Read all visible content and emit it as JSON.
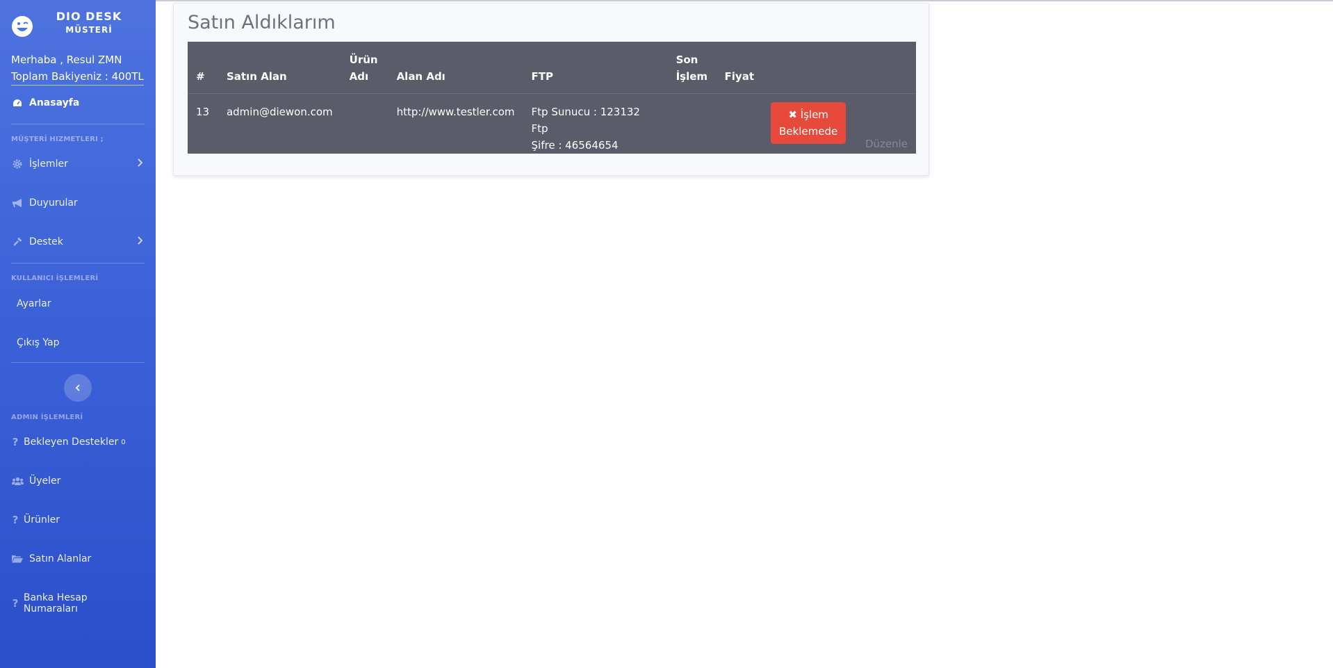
{
  "brand": {
    "title": "DIO DESK",
    "subtitle": "MÜSTERİ"
  },
  "user": {
    "greeting": "Merhaba , Resul ZMN",
    "balance": "Toplam Bakiyeniz : 400TL"
  },
  "nav": {
    "home": "Anasayfa",
    "heading_customer": "MÜŞTERİ HIZMETLERI ;",
    "operations": "İşlemler",
    "announcements": "Duyurular",
    "support": "Destek",
    "heading_user": "KULLANICI İŞLEMLERİ",
    "settings": "Ayarlar",
    "logout": "Çıkış Yap",
    "heading_admin": "ADMIN İŞLEMLERİ",
    "pending_support": "Bekleyen Destekler",
    "pending_count": "0",
    "members": "Üyeler",
    "products": "Ürünler",
    "buyers": "Satın Alanlar",
    "bank_accounts": "Banka Hesap Numaraları"
  },
  "main": {
    "title": "Satın Aldıklarım",
    "columns": [
      "#",
      "Satın Alan",
      "Ürün Adı",
      "Alan Adı",
      "FTP",
      "Son İşlem",
      "Fiyat"
    ],
    "rows": [
      {
        "id": "13",
        "buyer": "admin@diewon.com",
        "product": "",
        "domain": "http://www.testler.com",
        "ftp_line1": "Ftp Sunucu : 123132 Ftp",
        "ftp_line2": "Şifre : 46564654",
        "last_op": "",
        "price": "",
        "status_line1": "İşlem",
        "status_line2": "Beklemede",
        "edit": "Düzenle"
      }
    ]
  },
  "colors": {
    "sidebar_top": "#4e73df",
    "sidebar_bottom": "#2a4fc9",
    "table_bg": "#5a5c69",
    "danger": "#e74a3b"
  }
}
